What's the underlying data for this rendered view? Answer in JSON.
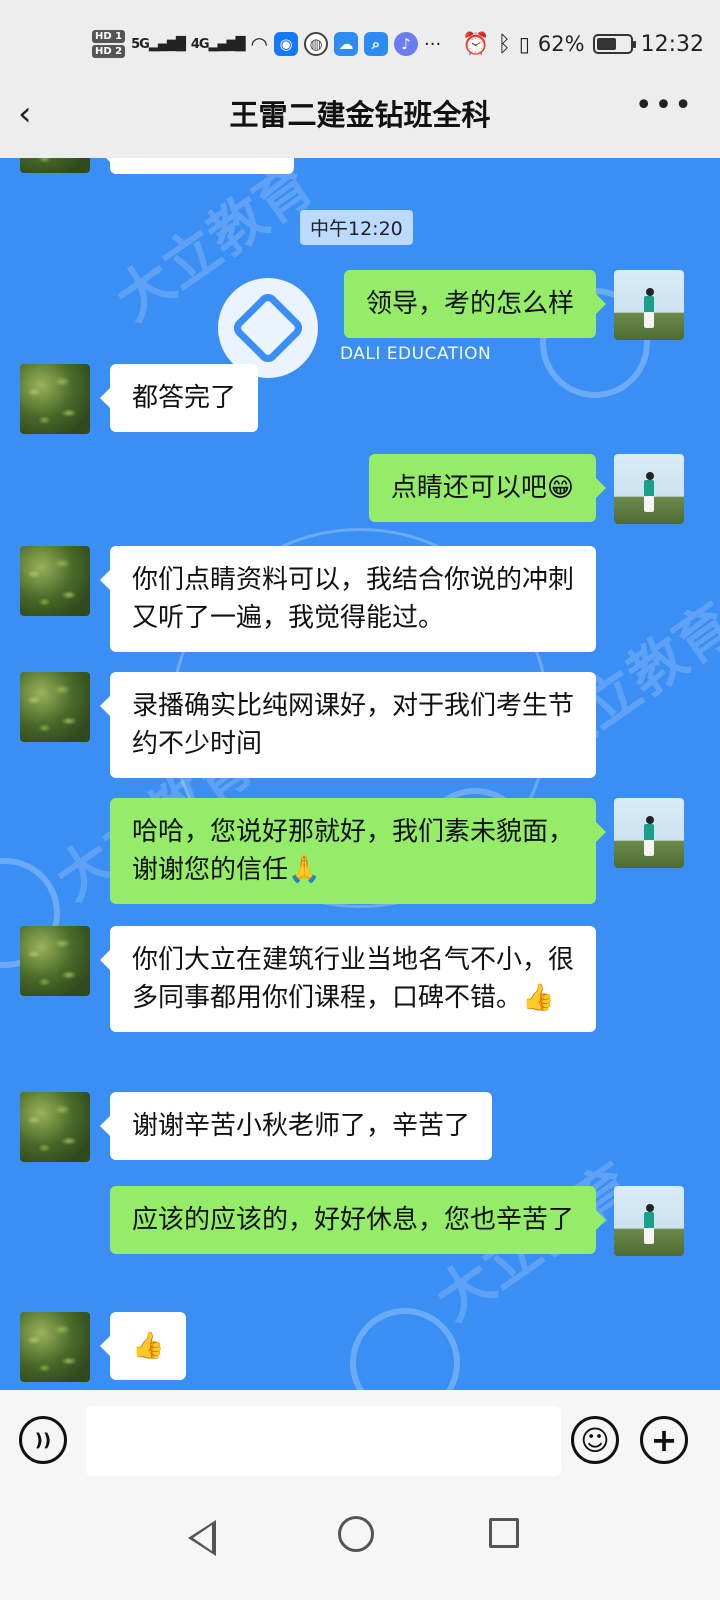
{
  "status_bar": {
    "sim1": "HD 1",
    "sim2": "HD 2",
    "net1": "5G",
    "net2": "4G",
    "battery_text": "62%",
    "battery_level_fraction": 0.62,
    "time": "12:32",
    "overflow": "···",
    "icons": [
      "wifi-icon",
      "bulb-app-icon",
      "globe-app-icon",
      "cloud-app-icon",
      "search-app-icon",
      "music-app-icon",
      "alarm-icon",
      "bluetooth-icon",
      "vibrate-icon",
      "battery-icon"
    ]
  },
  "header": {
    "back_icon": "chevron-left-icon",
    "title": "王雷二建金钻班全科",
    "more_icon": "more-dots-icon"
  },
  "chat": {
    "background_color": "#3a8ef4",
    "watermark": {
      "brand": "DALI EDUCATION"
    },
    "timestamp": "中午12:20",
    "messages": [
      {
        "side": "out",
        "text": "领导，考的怎么样"
      },
      {
        "side": "in",
        "text": "都答完了"
      },
      {
        "side": "out",
        "text": "点睛还可以吧",
        "emoji": "😁"
      },
      {
        "side": "in",
        "text": "你们点睛资料可以，我结合你说的冲刺又听了一遍，我觉得能过。"
      },
      {
        "side": "in",
        "text": "录播确实比纯网课好，对于我们考生节约不少时间"
      },
      {
        "side": "out",
        "text": "哈哈，您说好那就好，我们素未貌面，谢谢您的信任",
        "emoji": "🙏"
      },
      {
        "side": "in",
        "text": "你们大立在建筑行业当地名气不小，很多同事都用你们课程，口碑不错。",
        "emoji": "👍"
      },
      {
        "side": "in",
        "text": "谢谢辛苦小秋老师了，辛苦了"
      },
      {
        "side": "out",
        "text": "应该的应该的，好好休息，您也辛苦了"
      },
      {
        "side": "in",
        "text": "",
        "emoji": "👍"
      }
    ],
    "out_bubble_color": "#95ec69",
    "in_bubble_color": "#ffffff"
  },
  "input_bar": {
    "voice_icon": "voice-icon",
    "emoji_icon": "smiley-icon",
    "plus_icon": "plus-icon",
    "input_value": ""
  },
  "nav_bar": {
    "back_icon": "nav-back-icon",
    "home_icon": "nav-home-icon",
    "recents_icon": "nav-recents-icon"
  }
}
